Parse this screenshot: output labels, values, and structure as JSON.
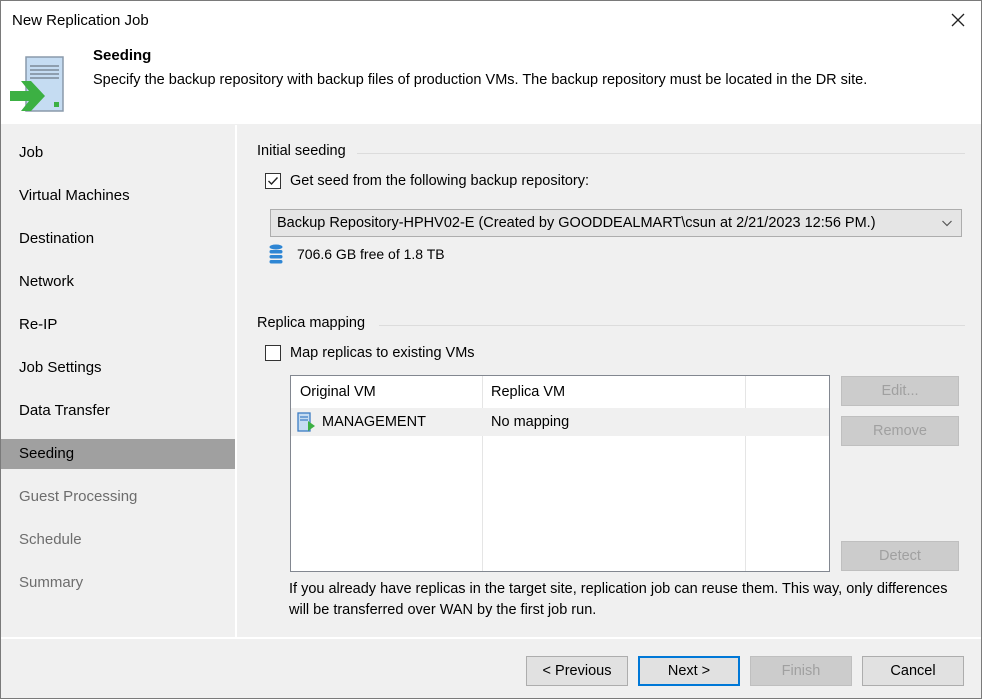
{
  "window": {
    "title": "New Replication Job",
    "close_icon": "close-icon"
  },
  "header": {
    "icon": "replication-seed-icon",
    "title": "Seeding",
    "description": "Specify the backup repository with backup files of production VMs. The backup repository must be located in the DR site."
  },
  "sidebar": {
    "items": [
      {
        "label": "Job",
        "state": "completed"
      },
      {
        "label": "Virtual Machines",
        "state": "completed"
      },
      {
        "label": "Destination",
        "state": "completed"
      },
      {
        "label": "Network",
        "state": "completed"
      },
      {
        "label": "Re-IP",
        "state": "completed"
      },
      {
        "label": "Job Settings",
        "state": "completed"
      },
      {
        "label": "Data Transfer",
        "state": "completed"
      },
      {
        "label": "Seeding",
        "state": "active"
      },
      {
        "label": "Guest Processing",
        "state": "pending"
      },
      {
        "label": "Schedule",
        "state": "pending"
      },
      {
        "label": "Summary",
        "state": "pending"
      }
    ]
  },
  "initial_seeding": {
    "group_label": "Initial seeding",
    "checkbox_label": "Get seed from the following backup repository:",
    "checked": true,
    "repository_selected": "Backup Repository-HPHV02-E (Created by GOODDEALMART\\csun at 2/21/2023 12:56 PM.)",
    "repository_icon": "database-icon",
    "free_space": "706.6 GB free of 1.8 TB"
  },
  "replica_mapping": {
    "group_label": "Replica mapping",
    "checkbox_label": "Map replicas to existing VMs",
    "checked": false,
    "table": {
      "columns": [
        "Original VM",
        "Replica VM",
        ""
      ],
      "rows": [
        {
          "original_vm": "MANAGEMENT",
          "replica_vm": "No mapping",
          "icon": "vm-icon"
        }
      ]
    },
    "buttons": {
      "edit": "Edit...",
      "remove": "Remove",
      "detect": "Detect"
    },
    "hint": "If you already have replicas in the target site, replication job can reuse them. This way, only differences will be transferred over WAN by the first job run."
  },
  "footer": {
    "previous": "< Previous",
    "next": "Next >",
    "finish": "Finish",
    "cancel": "Cancel"
  },
  "colors": {
    "accent": "#0078d7",
    "active_nav": "#a0a0a0",
    "icon_green": "#3cb043",
    "icon_blue": "#c5dcf2",
    "database_blue": "#2e86d4"
  }
}
